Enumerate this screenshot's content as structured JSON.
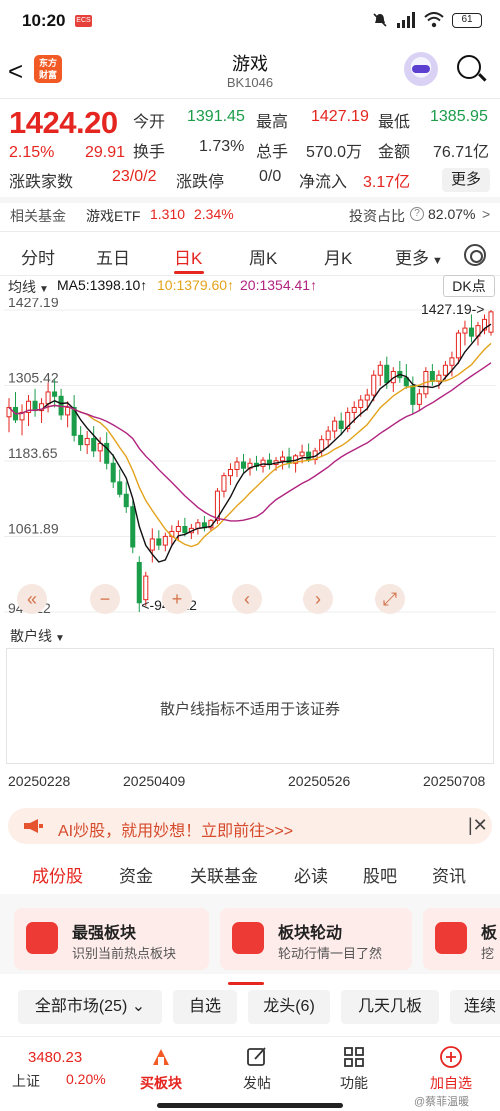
{
  "status_bar": {
    "time": "10:20",
    "app_badge": "ECS",
    "battery": "61"
  },
  "header": {
    "back": "<",
    "logo_line1": "东方",
    "logo_line2": "财富",
    "title": "游戏",
    "code": "BK1046"
  },
  "quote": {
    "price": "1424.20",
    "pct": "2.15%",
    "change": "29.91",
    "open_label": "今开",
    "open": "1391.45",
    "high_label": "最高",
    "high": "1427.19",
    "low_label": "最低",
    "low": "1385.95",
    "turnover_label": "换手",
    "turnover": "1.73%",
    "volume_label": "总手",
    "volume": "570.0万",
    "amount_label": "金额",
    "amount": "76.71亿",
    "updown_label": "涨跌家数",
    "updown": "23/0/2",
    "limit_label": "涨跌停",
    "limit": "0/0",
    "inflow_label": "净流入",
    "inflow": "3.17亿",
    "more": "更多"
  },
  "fund": {
    "label": "相关基金",
    "name": "游戏ETF",
    "price": "1.310",
    "pct": "2.34%",
    "ratio_label": "投资占比",
    "ratio_icon": "question-icon",
    "ratio": "82.07%",
    "arrow": ">"
  },
  "tabs": [
    "分时",
    "五日",
    "日K",
    "周K",
    "月K",
    "更多"
  ],
  "indicator": {
    "line_select": "均线",
    "ma5": "MA5:1398.10↑",
    "ma10": "10:1379.60↑",
    "ma20": "20:1354.41↑",
    "ma5_color": "#111111",
    "ma10_color": "#e3a21a",
    "ma20_color": "#b0237f",
    "dk": "DK点"
  },
  "chart_data": {
    "type": "candlestick",
    "y_labels": [
      "1427.19",
      "1305.42",
      "1183.65",
      "1061.89",
      "940.12"
    ],
    "ylim": [
      940.12,
      1427.19
    ],
    "annotations": [
      {
        "label": "1427.19->",
        "at": "max"
      },
      {
        "label": "<-940.12",
        "at": "min"
      }
    ],
    "x_dates": [
      "20250228",
      "20250409",
      "20250526",
      "20250708"
    ],
    "up_color": "#e5251f",
    "down_color": "#1b9d4a",
    "candles": [
      {
        "o": 1255,
        "h": 1285,
        "l": 1230,
        "c": 1270
      },
      {
        "o": 1270,
        "h": 1295,
        "l": 1245,
        "c": 1250
      },
      {
        "o": 1250,
        "h": 1275,
        "l": 1225,
        "c": 1262
      },
      {
        "o": 1262,
        "h": 1290,
        "l": 1240,
        "c": 1280
      },
      {
        "o": 1280,
        "h": 1300,
        "l": 1255,
        "c": 1265
      },
      {
        "o": 1265,
        "h": 1285,
        "l": 1245,
        "c": 1276
      },
      {
        "o": 1276,
        "h": 1310,
        "l": 1262,
        "c": 1295
      },
      {
        "o": 1295,
        "h": 1315,
        "l": 1270,
        "c": 1288
      },
      {
        "o": 1288,
        "h": 1300,
        "l": 1250,
        "c": 1258
      },
      {
        "o": 1258,
        "h": 1280,
        "l": 1238,
        "c": 1270
      },
      {
        "o": 1270,
        "h": 1290,
        "l": 1215,
        "c": 1225
      },
      {
        "o": 1225,
        "h": 1240,
        "l": 1200,
        "c": 1210
      },
      {
        "o": 1210,
        "h": 1232,
        "l": 1195,
        "c": 1220
      },
      {
        "o": 1220,
        "h": 1240,
        "l": 1190,
        "c": 1200
      },
      {
        "o": 1200,
        "h": 1222,
        "l": 1182,
        "c": 1212
      },
      {
        "o": 1212,
        "h": 1230,
        "l": 1170,
        "c": 1180
      },
      {
        "o": 1180,
        "h": 1195,
        "l": 1140,
        "c": 1150
      },
      {
        "o": 1150,
        "h": 1170,
        "l": 1125,
        "c": 1130
      },
      {
        "o": 1130,
        "h": 1150,
        "l": 1100,
        "c": 1110
      },
      {
        "o": 1110,
        "h": 1120,
        "l": 1035,
        "c": 1045
      },
      {
        "o": 1020,
        "h": 1030,
        "l": 940.12,
        "c": 955
      },
      {
        "o": 960,
        "h": 1005,
        "l": 950,
        "c": 998
      },
      {
        "o": 1040,
        "h": 1075,
        "l": 1020,
        "c": 1058
      },
      {
        "o": 1058,
        "h": 1072,
        "l": 1040,
        "c": 1048
      },
      {
        "o": 1048,
        "h": 1068,
        "l": 1038,
        "c": 1062
      },
      {
        "o": 1062,
        "h": 1080,
        "l": 1048,
        "c": 1070
      },
      {
        "o": 1070,
        "h": 1088,
        "l": 1055,
        "c": 1078
      },
      {
        "o": 1078,
        "h": 1092,
        "l": 1062,
        "c": 1068
      },
      {
        "o": 1068,
        "h": 1082,
        "l": 1058,
        "c": 1075
      },
      {
        "o": 1075,
        "h": 1090,
        "l": 1065,
        "c": 1084
      },
      {
        "o": 1084,
        "h": 1095,
        "l": 1070,
        "c": 1076
      },
      {
        "o": 1076,
        "h": 1090,
        "l": 1070,
        "c": 1088
      },
      {
        "o": 1088,
        "h": 1140,
        "l": 1082,
        "c": 1135
      },
      {
        "o": 1135,
        "h": 1165,
        "l": 1125,
        "c": 1160
      },
      {
        "o": 1160,
        "h": 1180,
        "l": 1145,
        "c": 1170
      },
      {
        "o": 1170,
        "h": 1190,
        "l": 1158,
        "c": 1182
      },
      {
        "o": 1182,
        "h": 1195,
        "l": 1165,
        "c": 1172
      },
      {
        "o": 1172,
        "h": 1188,
        "l": 1160,
        "c": 1180
      },
      {
        "o": 1180,
        "h": 1192,
        "l": 1168,
        "c": 1175
      },
      {
        "o": 1175,
        "h": 1190,
        "l": 1165,
        "c": 1185
      },
      {
        "o": 1185,
        "h": 1196,
        "l": 1170,
        "c": 1178
      },
      {
        "o": 1178,
        "h": 1190,
        "l": 1168,
        "c": 1184
      },
      {
        "o": 1184,
        "h": 1200,
        "l": 1170,
        "c": 1190
      },
      {
        "o": 1190,
        "h": 1205,
        "l": 1172,
        "c": 1180
      },
      {
        "o": 1180,
        "h": 1195,
        "l": 1165,
        "c": 1192
      },
      {
        "o": 1192,
        "h": 1210,
        "l": 1180,
        "c": 1198
      },
      {
        "o": 1198,
        "h": 1212,
        "l": 1182,
        "c": 1186
      },
      {
        "o": 1186,
        "h": 1205,
        "l": 1178,
        "c": 1200
      },
      {
        "o": 1200,
        "h": 1225,
        "l": 1190,
        "c": 1218
      },
      {
        "o": 1218,
        "h": 1240,
        "l": 1205,
        "c": 1232
      },
      {
        "o": 1232,
        "h": 1255,
        "l": 1220,
        "c": 1248
      },
      {
        "o": 1248,
        "h": 1262,
        "l": 1225,
        "c": 1236
      },
      {
        "o": 1236,
        "h": 1270,
        "l": 1230,
        "c": 1262
      },
      {
        "o": 1262,
        "h": 1280,
        "l": 1245,
        "c": 1270
      },
      {
        "o": 1270,
        "h": 1290,
        "l": 1255,
        "c": 1282
      },
      {
        "o": 1282,
        "h": 1300,
        "l": 1265,
        "c": 1290
      },
      {
        "o": 1290,
        "h": 1330,
        "l": 1280,
        "c": 1322
      },
      {
        "o": 1322,
        "h": 1345,
        "l": 1305,
        "c": 1338
      },
      {
        "o": 1338,
        "h": 1352,
        "l": 1300,
        "c": 1310
      },
      {
        "o": 1310,
        "h": 1335,
        "l": 1295,
        "c": 1328
      },
      {
        "o": 1328,
        "h": 1345,
        "l": 1310,
        "c": 1318
      },
      {
        "o": 1318,
        "h": 1340,
        "l": 1300,
        "c": 1305
      },
      {
        "o": 1305,
        "h": 1320,
        "l": 1260,
        "c": 1275
      },
      {
        "o": 1275,
        "h": 1300,
        "l": 1265,
        "c": 1292
      },
      {
        "o": 1292,
        "h": 1335,
        "l": 1285,
        "c": 1328
      },
      {
        "o": 1328,
        "h": 1340,
        "l": 1305,
        "c": 1312
      },
      {
        "o": 1312,
        "h": 1330,
        "l": 1300,
        "c": 1322
      },
      {
        "o": 1322,
        "h": 1345,
        "l": 1315,
        "c": 1338
      },
      {
        "o": 1338,
        "h": 1360,
        "l": 1320,
        "c": 1350
      },
      {
        "o": 1350,
        "h": 1395,
        "l": 1340,
        "c": 1390
      },
      {
        "o": 1390,
        "h": 1410,
        "l": 1370,
        "c": 1398
      },
      {
        "o": 1398,
        "h": 1420,
        "l": 1375,
        "c": 1385
      },
      {
        "o": 1385,
        "h": 1408,
        "l": 1370,
        "c": 1402
      },
      {
        "o": 1395,
        "h": 1420,
        "l": 1388,
        "c": 1412
      },
      {
        "o": 1391.45,
        "h": 1427.19,
        "l": 1385.95,
        "c": 1424.2
      }
    ]
  },
  "sub_indicator": {
    "name": "散户线",
    "message": "散户线指标不适用于该证券"
  },
  "banner": {
    "text": "AI炒股，就用妙想！立即前往>>>"
  },
  "bottom_tabs": [
    "成份股",
    "资金",
    "关联基金",
    "必读",
    "股吧",
    "资讯"
  ],
  "cards": [
    {
      "title": "最强板块",
      "subtitle": "识别当前热点板块"
    },
    {
      "title": "板块轮动",
      "subtitle": "轮动行情一目了然"
    },
    {
      "title": "板",
      "subtitle": "挖"
    }
  ],
  "filters": [
    "全部市场(25)",
    "自选",
    "龙头(6)",
    "几天几板",
    "连续"
  ],
  "bottom_nav": {
    "index_value": "3480.23",
    "index_name": "上证",
    "index_pct": "0.20%",
    "items": [
      "买板块",
      "发帖",
      "功能",
      "加自选"
    ],
    "watermark": "@蔡菲温暖"
  }
}
